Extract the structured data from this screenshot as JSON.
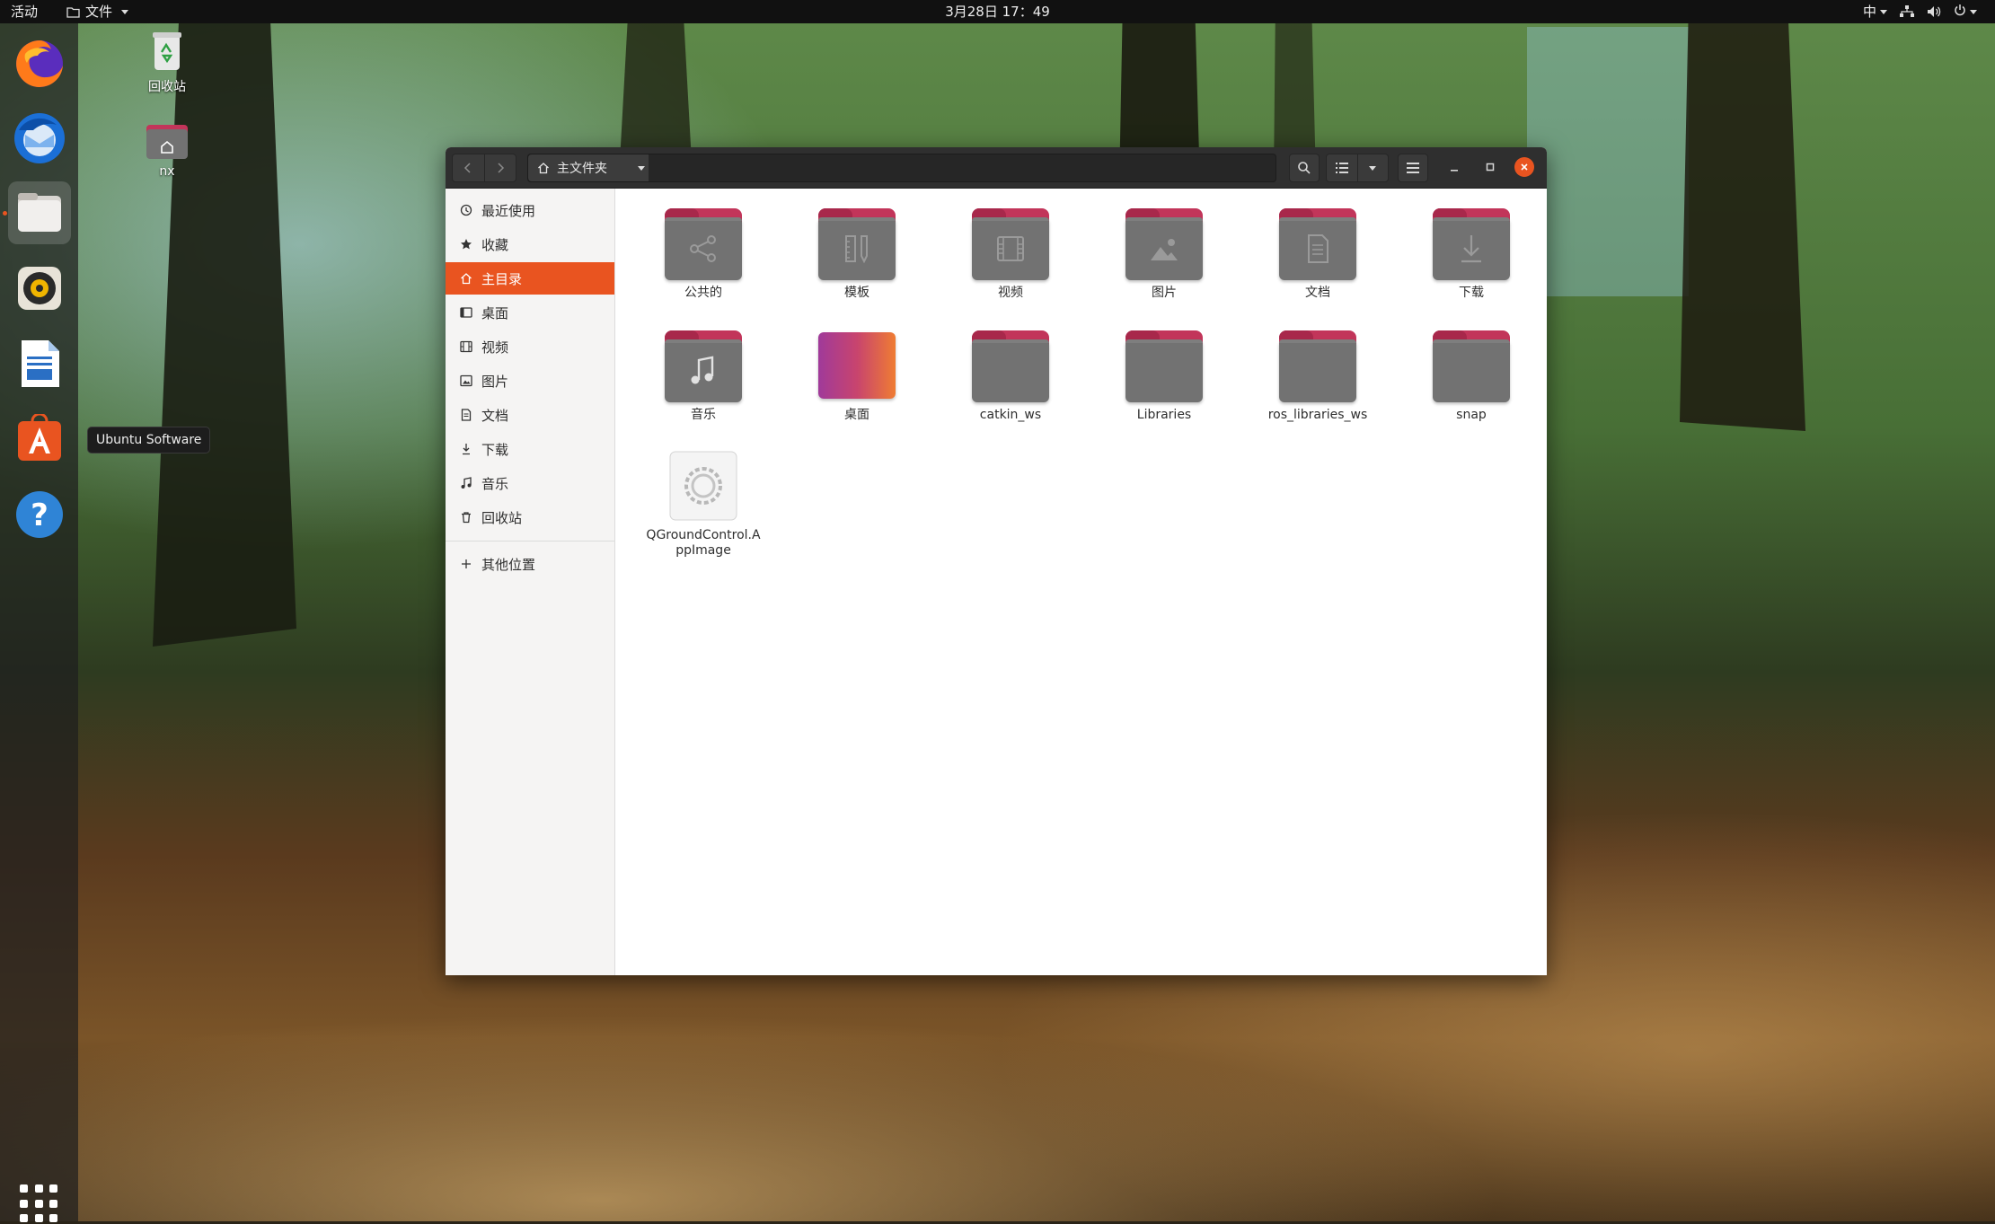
{
  "topbar": {
    "activities": "活动",
    "app_menu": "文件",
    "clock": "3月28日 17：49",
    "input_method": "中"
  },
  "dock": {
    "items": [
      {
        "name": "firefox",
        "icon": "firefox-icon"
      },
      {
        "name": "thunderbird",
        "icon": "thunderbird-icon"
      },
      {
        "name": "files",
        "icon": "files-icon",
        "active": true
      },
      {
        "name": "rhythmbox",
        "icon": "rhythmbox-icon"
      },
      {
        "name": "libreoffice-writer",
        "icon": "writer-icon"
      },
      {
        "name": "ubuntu-software",
        "icon": "ubuntu-software-icon"
      },
      {
        "name": "help",
        "icon": "help-icon"
      }
    ],
    "tooltip": "Ubuntu Software"
  },
  "desktop": {
    "icons": [
      {
        "label": "回收站",
        "icon": "trash-icon"
      },
      {
        "label": "nx",
        "icon": "home-folder-icon"
      }
    ]
  },
  "window": {
    "breadcrumb": "主文件夹",
    "sidebar": {
      "items": [
        {
          "label": "最近使用",
          "icon": "recent-icon"
        },
        {
          "label": "收藏",
          "icon": "star-icon"
        },
        {
          "label": "主目录",
          "icon": "home-icon",
          "selected": true
        },
        {
          "label": "桌面",
          "icon": "desktop-icon"
        },
        {
          "label": "视频",
          "icon": "video-icon"
        },
        {
          "label": "图片",
          "icon": "pictures-icon"
        },
        {
          "label": "文档",
          "icon": "documents-icon"
        },
        {
          "label": "下载",
          "icon": "download-icon"
        },
        {
          "label": "音乐",
          "icon": "music-icon"
        },
        {
          "label": "回收站",
          "icon": "trash-icon"
        }
      ],
      "other_locations": "其他位置"
    },
    "files": [
      {
        "name": "公共的",
        "icon": "share-icon"
      },
      {
        "name": "模板",
        "icon": "template-icon"
      },
      {
        "name": "视频",
        "icon": "video-icon"
      },
      {
        "name": "图片",
        "icon": "pictures-icon"
      },
      {
        "name": "文档",
        "icon": "documents-icon"
      },
      {
        "name": "下载",
        "icon": "download-icon"
      },
      {
        "name": "音乐",
        "icon": "music-icon"
      },
      {
        "name": "桌面",
        "icon": "desktop-folder"
      },
      {
        "name": "catkin_ws",
        "icon": "folder"
      },
      {
        "name": "Libraries",
        "icon": "folder"
      },
      {
        "name": "ros_libraries_ws",
        "icon": "folder"
      },
      {
        "name": "snap",
        "icon": "folder"
      },
      {
        "name": "QGroundControl.AppImage",
        "icon": "gear-icon"
      }
    ]
  },
  "colors": {
    "accent": "#e95420",
    "folder_tab": "#c2355a",
    "folder_body": "#727272",
    "headerbar": "#2f2f2f"
  }
}
